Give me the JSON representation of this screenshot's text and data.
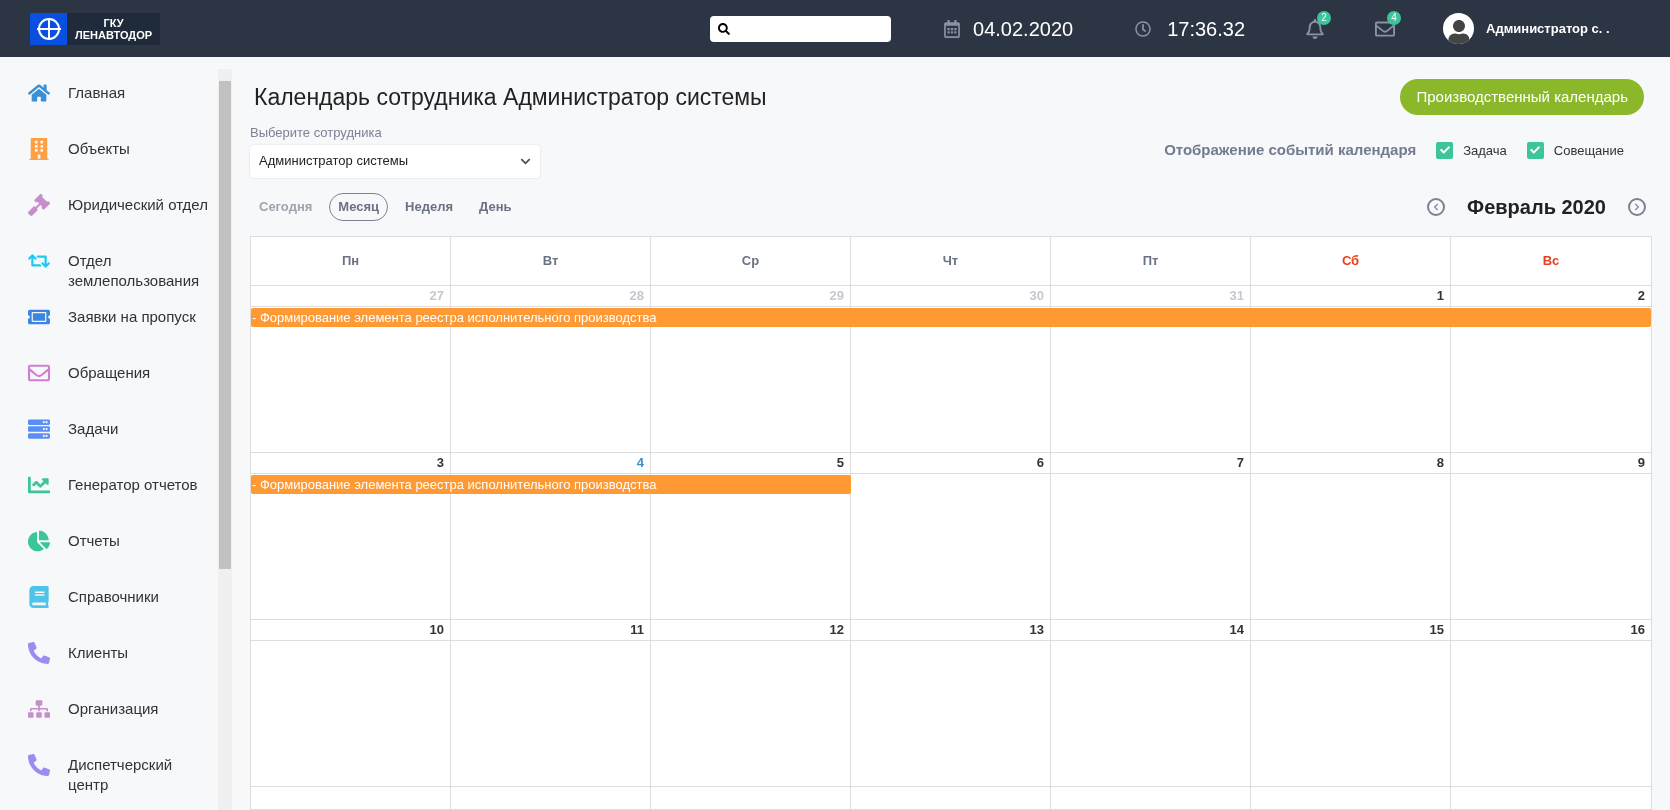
{
  "header": {
    "logo": {
      "line1": "ГКУ",
      "line2": "ЛЕНАВТОДОР"
    },
    "date": "04.02.2020",
    "time": "17:36.32",
    "notifications": "2",
    "messages": "4",
    "user": "Администратор с. ."
  },
  "sidebar": {
    "items": [
      {
        "label": "Главная",
        "color": "#3b8fd4"
      },
      {
        "label": "Объекты",
        "color": "#ff9f43"
      },
      {
        "label": "Юридический отдел",
        "color": "#c58fc9"
      },
      {
        "label": "Отдел землепользования",
        "color": "#1ec8f0"
      },
      {
        "label": "Заявки на пропуск",
        "color": "#3a86e0"
      },
      {
        "label": "Обращения",
        "color": "#d07dd6"
      },
      {
        "label": "Задачи",
        "color": "#5b8ef5"
      },
      {
        "label": "Генератор отчетов",
        "color": "#3cc49a"
      },
      {
        "label": "Отчеты",
        "color": "#3cc49a"
      },
      {
        "label": "Справочники",
        "color": "#4fc3e8"
      },
      {
        "label": "Клиенты",
        "color": "#9a8cf2"
      },
      {
        "label": "Организация",
        "color": "#c58fc9"
      },
      {
        "label": "Диспетчерский центр",
        "color": "#9a8cf2"
      }
    ]
  },
  "page": {
    "title": "Календарь сотрудника Администратор системы",
    "calendar_button": "Производственный календарь",
    "employee": {
      "label": "Выберите сотрудника",
      "value": "Администратор системы"
    },
    "filters": {
      "label": "Отображение событий календаря",
      "items": [
        {
          "label": "Задача",
          "checked": true
        },
        {
          "label": "Совещание",
          "checked": true
        }
      ]
    },
    "views": [
      {
        "label": "Сегодня",
        "disabled": true,
        "selected": false
      },
      {
        "label": "Месяц",
        "disabled": false,
        "selected": true
      },
      {
        "label": "Неделя",
        "disabled": false,
        "selected": false
      },
      {
        "label": "День",
        "disabled": false,
        "selected": false
      }
    ],
    "month": "Февраль 2020"
  },
  "calendar": {
    "weekdays": [
      {
        "label": "Пн",
        "weekend": false
      },
      {
        "label": "Вт",
        "weekend": false
      },
      {
        "label": "Ср",
        "weekend": false
      },
      {
        "label": "Чт",
        "weekend": false
      },
      {
        "label": "Пт",
        "weekend": false
      },
      {
        "label": "Сб",
        "weekend": true
      },
      {
        "label": "Вс",
        "weekend": true
      }
    ],
    "weeks": [
      {
        "days": [
          {
            "label": "27",
            "kind": "other"
          },
          {
            "label": "28",
            "kind": "other"
          },
          {
            "label": "29",
            "kind": "other"
          },
          {
            "label": "30",
            "kind": "other"
          },
          {
            "label": "31",
            "kind": "other"
          },
          {
            "label": "1",
            "kind": "current"
          },
          {
            "label": "2",
            "kind": "current"
          }
        ],
        "events": [
          {
            "title": "- Формирование элемента реестра исполнительного производства",
            "level": 1
          }
        ]
      },
      {
        "days": [
          {
            "label": "3",
            "kind": "current"
          },
          {
            "label": "4",
            "kind": "today"
          },
          {
            "label": "5",
            "kind": "current"
          },
          {
            "label": "6",
            "kind": "current"
          },
          {
            "label": "7",
            "kind": "current"
          },
          {
            "label": "8",
            "kind": "current"
          },
          {
            "label": "9",
            "kind": "current"
          }
        ],
        "events": [
          {
            "title": "- Формирование элемента реестра исполнительного производства",
            "level": 0.4286
          }
        ]
      },
      {
        "days": [
          {
            "label": "10",
            "kind": "current"
          },
          {
            "label": "11",
            "kind": "current"
          },
          {
            "label": "12",
            "kind": "current"
          },
          {
            "label": "13",
            "kind": "current"
          },
          {
            "label": "14",
            "kind": "current"
          },
          {
            "label": "15",
            "kind": "current"
          },
          {
            "label": "16",
            "kind": "current"
          }
        ]
      }
    ]
  }
}
